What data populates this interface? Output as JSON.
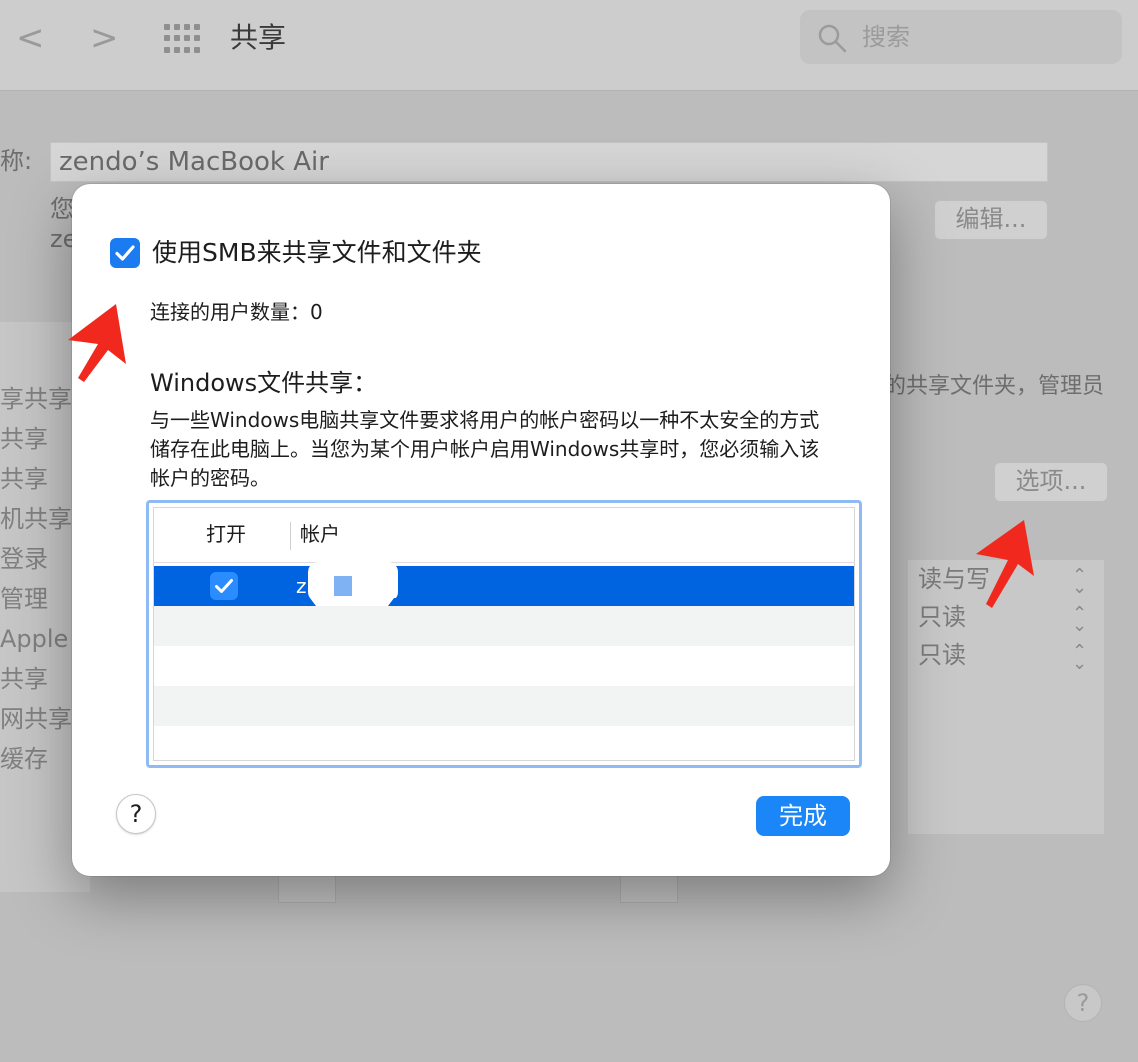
{
  "toolbar": {
    "back_label": "<",
    "forward_label": ">",
    "title": "共享",
    "search_placeholder": "搜索"
  },
  "background": {
    "name_label": "称:",
    "computer_name": "zendo’s MacBook Air",
    "sub_line1": "您",
    "sub_line2": "ze",
    "edit_button": "编辑...",
    "options_button": "选项...",
    "right_text": "的共享文件夹，管理员",
    "service_items": [
      "享共享",
      "共享",
      "共享",
      "机共享",
      "登录",
      "管理",
      "Apple",
      "共享",
      "网共享",
      "缓存"
    ],
    "permissions": [
      "读与写",
      "只读",
      "只读"
    ],
    "help_label": "?"
  },
  "dialog": {
    "smb_checkbox_label": "使用SMB来共享文件和文件夹",
    "smb_checked": true,
    "connected_users_label": "连接的用户数量：0",
    "windows_heading": "Windows文件共享：",
    "windows_description": "与一些Windows电脑共享文件要求将用户的帐户密码以一种不太安全的方式储存在此电脑上。当您为某个用户帐户启用Windows共享时，您必须输入该帐户的密码。",
    "table": {
      "columns": [
        "打开",
        "帐户"
      ],
      "rows": [
        {
          "enabled": true,
          "account": "z",
          "selected": true
        }
      ]
    },
    "help_label": "?",
    "done_button": "完成"
  },
  "colors": {
    "accent": "#1a86f7",
    "selection": "#0063e0",
    "annotation_arrow": "#f0281e"
  }
}
